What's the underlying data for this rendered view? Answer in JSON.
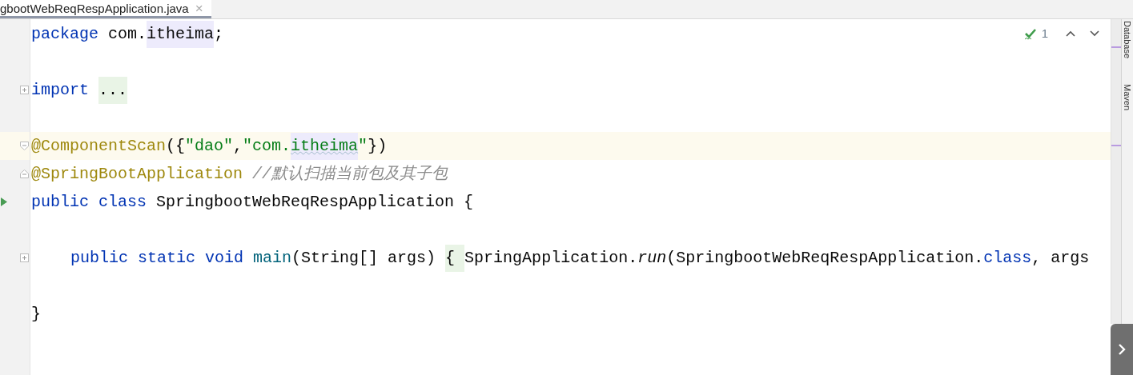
{
  "tab": {
    "title": "gbootWebReqRespApplication.java",
    "selected": true,
    "close": "×"
  },
  "inspections": {
    "count": "1"
  },
  "code_lines": [
    {
      "current": false,
      "segments": [
        {
          "text": "package",
          "kind": "keyword"
        },
        {
          "text": " com.",
          "kind": "plain"
        },
        {
          "text": "itheima",
          "kind": "highlight"
        },
        {
          "text": ";",
          "kind": "plain"
        }
      ]
    },
    {
      "current": false
    },
    {
      "gutter": {
        "kind": "fold_plus"
      },
      "current": false,
      "segments": [
        {
          "text": "import ",
          "kind": "keyword"
        },
        {
          "text": "...",
          "kind": "folded"
        }
      ]
    },
    {
      "current": false
    },
    {
      "gutter": {
        "kind": "fold_start"
      },
      "current": true,
      "segments": [
        {
          "text": "@ComponentScan",
          "kind": "annotation"
        },
        {
          "text": "({",
          "kind": "plain"
        },
        {
          "text": "\"dao\"",
          "kind": "string"
        },
        {
          "text": ",",
          "kind": "plain"
        },
        {
          "text": "\"com.",
          "kind": "string"
        },
        {
          "text": "itheima",
          "kind": "string_highlight"
        },
        {
          "text": "\"",
          "kind": "string"
        },
        {
          "text": "})",
          "kind": "plain"
        }
      ]
    },
    {
      "gutter": {
        "kind": "fold_end"
      },
      "current": false,
      "segments": [
        {
          "text": "@SpringBootApplication ",
          "kind": "annotation"
        },
        {
          "text": "//默认扫描当前包及其子包",
          "kind": "comment"
        }
      ]
    },
    {
      "gutter": {
        "kind": "run"
      },
      "current": false,
      "segments": [
        {
          "text": "public class",
          "kind": "keyword"
        },
        {
          "text": " SpringbootWebReqRespApplication {",
          "kind": "plain"
        }
      ]
    },
    {
      "current": false
    },
    {
      "gutter": {
        "kind": "fold_plus"
      },
      "indented": true,
      "current": false,
      "segments": [
        {
          "text": "public static void ",
          "kind": "keyword"
        },
        {
          "text": "main",
          "kind": "declaration"
        },
        {
          "text": "(String[] args) ",
          "kind": "plain"
        },
        {
          "text": "{ ",
          "kind": "folded"
        },
        {
          "text": "SpringApplication.",
          "kind": "plain"
        },
        {
          "text": "run",
          "kind": "static_call"
        },
        {
          "text": "(SpringbootWebReqRespApplication.",
          "kind": "plain"
        },
        {
          "text": "class",
          "kind": "keyword"
        },
        {
          "text": ", args",
          "kind": "plain"
        }
      ]
    },
    {
      "current": false
    },
    {
      "current": false,
      "segments": [
        {
          "text": "}",
          "kind": "plain"
        }
      ]
    }
  ],
  "tool_strip": [
    {
      "label": "Database"
    },
    {
      "label": "Maven"
    }
  ]
}
